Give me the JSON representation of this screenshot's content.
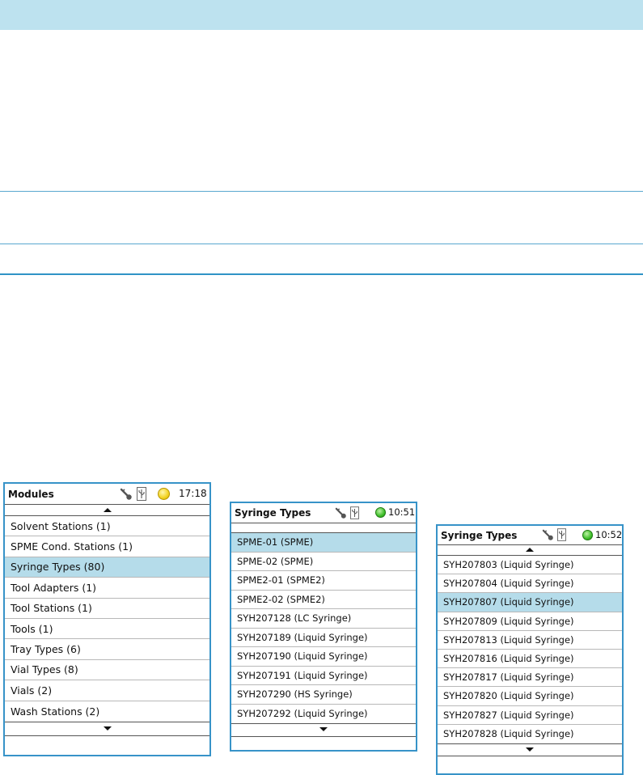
{
  "panels": [
    {
      "id": "modules",
      "title": "Modules",
      "led": "yellow",
      "time": "17:18",
      "items": [
        "Solvent Stations (1)",
        "SPME Cond. Stations (1)",
        "Syringe Types (80)",
        "Tool Adapters (1)",
        "Tool Stations (1)",
        "Tools (1)",
        "Tray Types (6)",
        "Vial Types (8)",
        "Vials (2)",
        "Wash Stations (2)"
      ],
      "selected_index": 2
    },
    {
      "id": "syringe-types-1",
      "title": "Syringe Types",
      "led": "green",
      "time": "10:51",
      "items": [
        "SPME-01 (SPME)",
        "SPME-02 (SPME)",
        "SPME2-01 (SPME2)",
        "SPME2-02 (SPME2)",
        "SYH207128 (LC Syringe)",
        "SYH207189 (Liquid Syringe)",
        "SYH207190 (Liquid Syringe)",
        "SYH207191 (Liquid Syringe)",
        "SYH207290 (HS Syringe)",
        "SYH207292 (Liquid Syringe)"
      ],
      "selected_index": 0
    },
    {
      "id": "syringe-types-2",
      "title": "Syringe Types",
      "led": "green",
      "time": "10:52",
      "items": [
        "SYH207803 (Liquid Syringe)",
        "SYH207804 (Liquid Syringe)",
        "SYH207807 (Liquid Syringe)",
        "SYH207809 (Liquid Syringe)",
        "SYH207813 (Liquid Syringe)",
        "SYH207816 (Liquid Syringe)",
        "SYH207817 (Liquid Syringe)",
        "SYH207820 (Liquid Syringe)",
        "SYH207827 (Liquid Syringe)",
        "SYH207828 (Liquid Syringe)"
      ],
      "selected_index": 2
    }
  ],
  "icons": {
    "key": "key-icon",
    "usb": "usb-icon",
    "scroll_up": "arrow-up-icon",
    "scroll_down": "arrow-down-icon"
  },
  "colors": {
    "frame": "#3793c8",
    "selection": "#b5dcea",
    "top_band": "#bde2ef",
    "led_yellow": "#f2d21f",
    "led_green": "#3fbf2a"
  }
}
